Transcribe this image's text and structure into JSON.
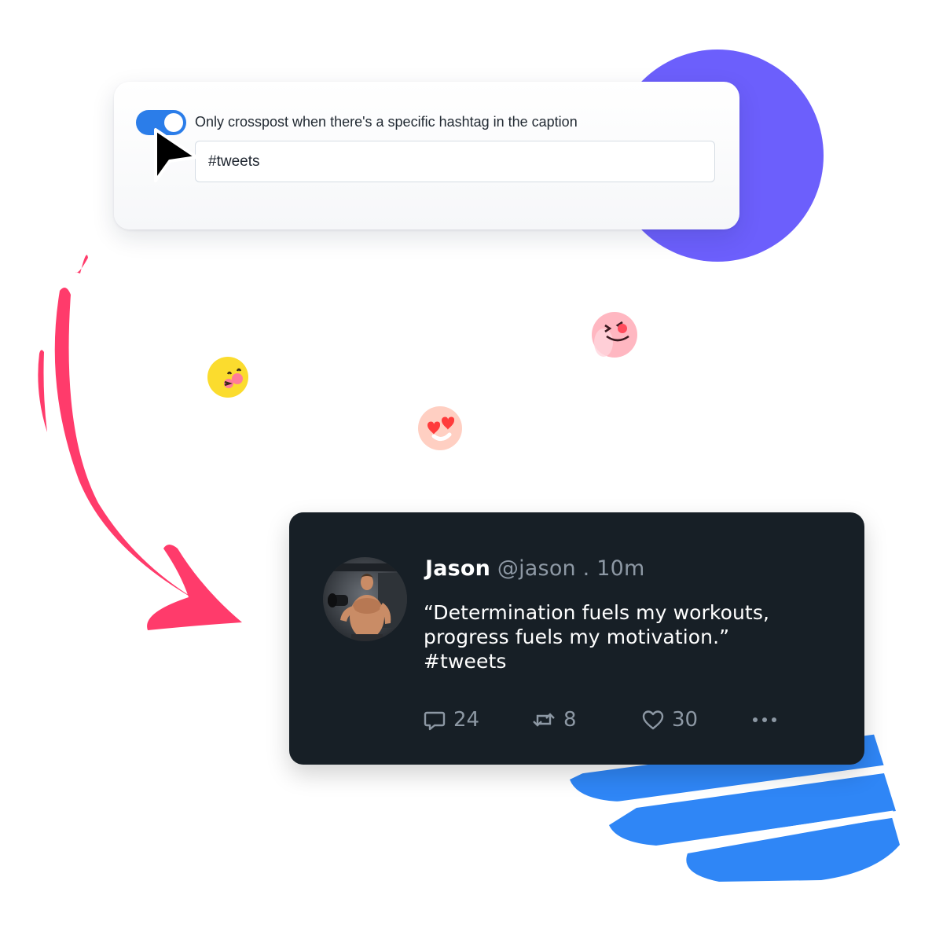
{
  "crosspost_settings": {
    "toggle_state": "on",
    "label": "Only crosspost when there's a specific hashtag in the caption",
    "hashtag_value": "#tweets"
  },
  "tweet": {
    "name": "Jason",
    "handle": "@jason",
    "separator": ".",
    "time": "10m",
    "text_line1": "“Determination fuels my workouts,",
    "text_line2": "progress fuels my motivation.”",
    "text_line3": "#tweets",
    "replies": "24",
    "retweets": "8",
    "likes": "30"
  },
  "colors": {
    "toggle": "#2b7de9",
    "purple_circle": "#6c5ffc",
    "arrow": "#ff3b6b",
    "blue_stripes": "#2f86f6",
    "tweet_bg": "#171f26"
  },
  "icons": [
    "cursor-arrow-icon",
    "reply-icon",
    "retweet-icon",
    "like-icon",
    "more-icon",
    "emoji-hot-face-icon",
    "emoji-heart-eyes-icon",
    "emoji-wink-tongue-icon"
  ]
}
